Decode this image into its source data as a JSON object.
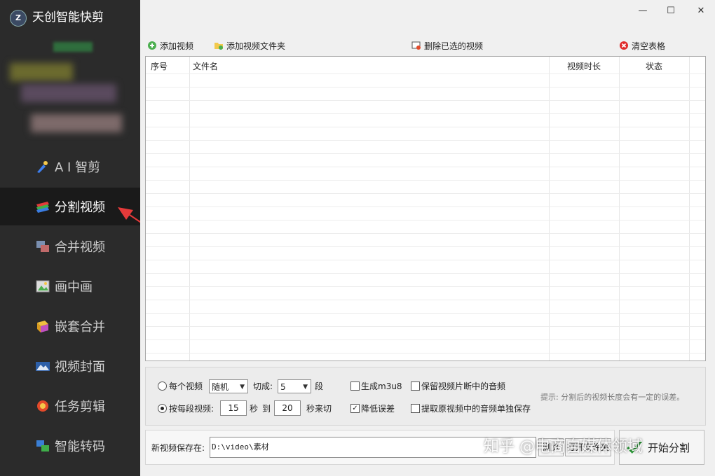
{
  "app": {
    "title": "天创智能快剪",
    "logo_text": "Z"
  },
  "sidebar": {
    "items": [
      {
        "label": "A I 智剪",
        "icon": "ai-cut-icon",
        "active": false
      },
      {
        "label": "分割视频",
        "icon": "split-video-icon",
        "active": true
      },
      {
        "label": "合并视频",
        "icon": "merge-video-icon",
        "active": false
      },
      {
        "label": "画中画",
        "icon": "picture-in-picture-icon",
        "active": false
      },
      {
        "label": "嵌套合并",
        "icon": "nested-merge-icon",
        "active": false
      },
      {
        "label": "视频封面",
        "icon": "video-cover-icon",
        "active": false
      },
      {
        "label": "任务剪辑",
        "icon": "task-edit-icon",
        "active": false
      },
      {
        "label": "智能转码",
        "icon": "smart-transcode-icon",
        "active": false
      }
    ]
  },
  "window": {
    "minimize": "—",
    "maximize": "☐",
    "close": "✕"
  },
  "toolbar": {
    "add_video": "添加视频",
    "add_folder": "添加视频文件夹",
    "delete_selected": "删除已选的视频",
    "clear_table": "清空表格"
  },
  "table": {
    "columns": [
      "序号",
      "文件名",
      "视频时长",
      "状态"
    ],
    "rows": []
  },
  "options": {
    "per_video_label": "每个视频",
    "per_video_mode": "随机",
    "cut_into_label": "切成:",
    "segments": "5",
    "segments_unit": "段",
    "gen_m3u8": "生成m3u8",
    "keep_audio": "保留视频片断中的音频",
    "per_segment_label": "按每段视频:",
    "seg_from": "15",
    "seconds_label": "秒",
    "to_label": "到",
    "seg_to": "20",
    "seconds_cut_label": "秒来切",
    "reduce_error": "降低误差",
    "extract_audio": "提取原视频中的音频单独保存",
    "hint": "提示: 分割后的视频长度会有一定的误差。"
  },
  "save": {
    "label": "新视频保存在:",
    "path": "D:\\video\\素材",
    "browse_label": "浏览",
    "open_folder_label": "打开文件夹",
    "start_label": "开始分割"
  },
  "watermark": "知乎 @电商自媒体领域",
  "colors": {
    "arrow": "#e53a3a",
    "sidebar_bg": "#2b2b2b",
    "sidebar_active": "#1a1a1a"
  }
}
